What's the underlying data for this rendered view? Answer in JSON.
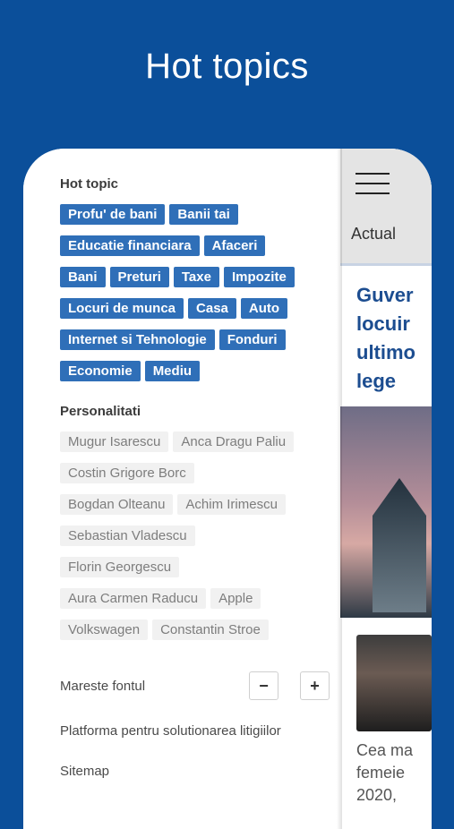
{
  "page": {
    "heading": "Hot topics"
  },
  "menu": {
    "hot_topic_title": "Hot topic",
    "hot_topics": [
      [
        "Profu' de bani",
        "Banii tai"
      ],
      [
        "Educatie financiara",
        "Afaceri"
      ],
      [
        "Bani",
        "Preturi",
        "Taxe",
        "Impozite"
      ],
      [
        "Locuri de munca",
        "Casa",
        "Auto"
      ],
      [
        "Internet si Tehnologie",
        "Fonduri"
      ],
      [
        "Economie",
        "Mediu"
      ]
    ],
    "personalities_title": "Personalitati",
    "personalities": [
      [
        "Mugur Isarescu",
        "Anca Dragu Paliu"
      ],
      [
        "Costin Grigore Borc"
      ],
      [
        "Bogdan Olteanu",
        "Achim Irimescu"
      ],
      [
        "Sebastian Vladescu"
      ],
      [
        "Florin Georgescu"
      ],
      [
        "Aura Carmen Raducu",
        "Apple"
      ],
      [
        "Volkswagen",
        "Constantin Stroe"
      ]
    ],
    "font_size_label": "Mareste fontul",
    "font_decrease": "−",
    "font_increase": "+",
    "dispute_link": "Platforma pentru solutionarea litigiilor",
    "sitemap_link": "Sitemap"
  },
  "preview": {
    "tab": "Actual",
    "headline_lines": [
      "Guver",
      "locuir",
      "ultimo",
      "lege"
    ],
    "caption_lines": [
      "Cea ma",
      "femeie",
      "2020,"
    ]
  },
  "icons": {
    "menu": "hamburger-icon"
  },
  "colors": {
    "background": "#0b4f9a",
    "chip_blue": "#2f6fb8",
    "headline": "#1c4d90"
  }
}
